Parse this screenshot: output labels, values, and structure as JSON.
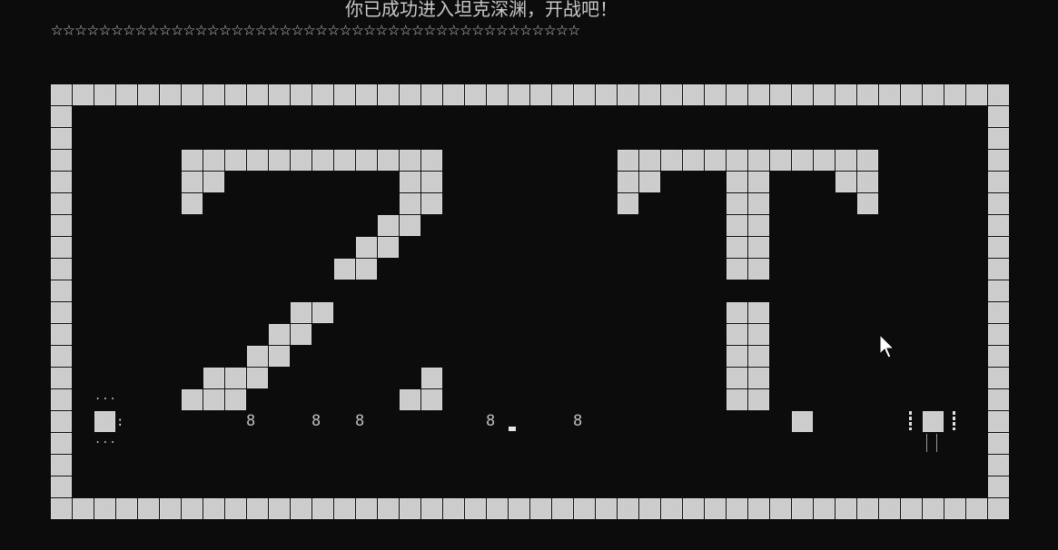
{
  "title": "你已成功进入坦克深渊，开战吧！",
  "stars": "☆☆☆☆☆☆☆☆☆☆☆☆☆☆☆☆☆☆☆☆☆☆☆☆☆☆☆☆☆☆☆☆☆☆☆☆☆☆☆☆☆☆☆☆",
  "grid": {
    "cols": 44,
    "rows": 20,
    "letters": "ZT"
  },
  "markers": [
    "8",
    "8",
    "8",
    "8",
    "8"
  ],
  "player_tank": {
    "dots_top": "...",
    "dots_bottom": "...",
    "colon": ":"
  },
  "colors": {
    "background": "#0c0c0c",
    "tile": "#cccccc",
    "text": "#c8c8c8"
  }
}
